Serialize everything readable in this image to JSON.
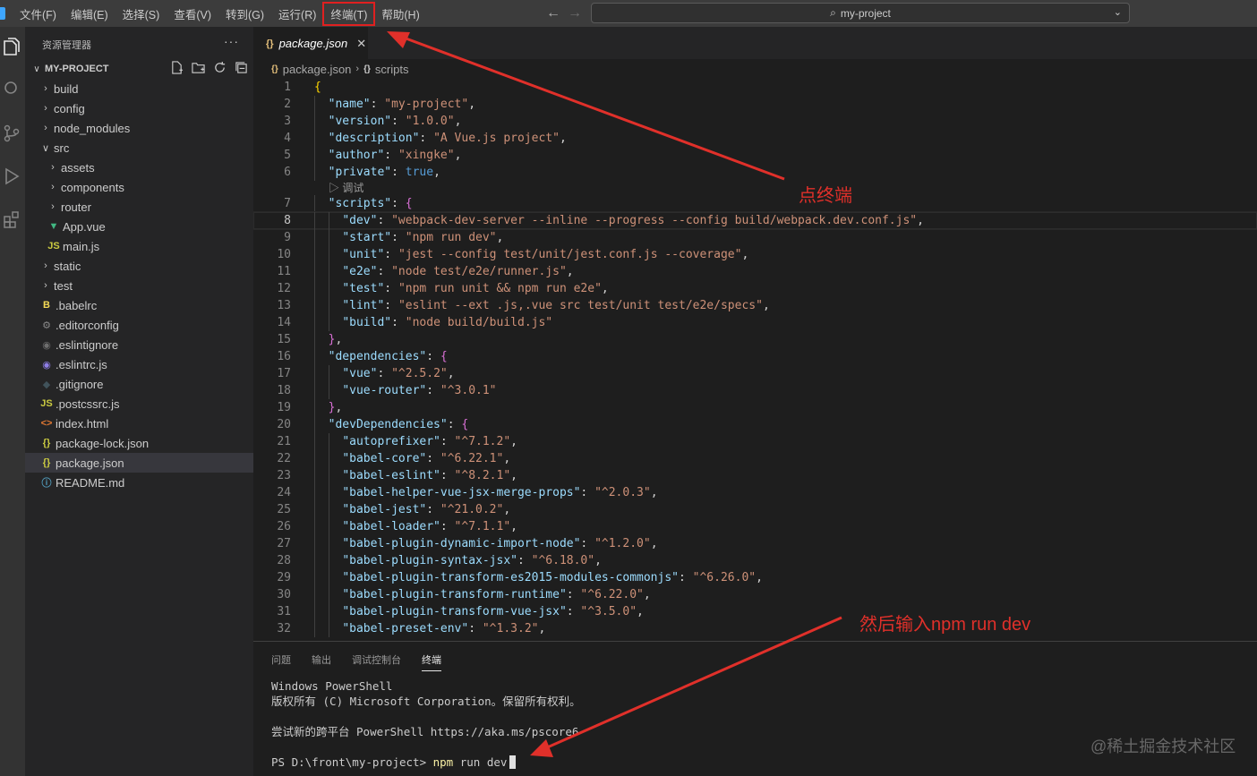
{
  "menu": {
    "items": [
      "文件(F)",
      "编辑(E)",
      "选择(S)",
      "查看(V)",
      "转到(G)",
      "运行(R)",
      "终端(T)",
      "帮助(H)"
    ],
    "highlighted_item": "终端(T)"
  },
  "command_center": {
    "text": "my-project",
    "icon": "search-icon"
  },
  "sidebar": {
    "title": "资源管理器",
    "more": "···",
    "project": "MY-PROJECT",
    "tree": [
      {
        "label": "build",
        "type": "folder",
        "expanded": false,
        "depth": 1
      },
      {
        "label": "config",
        "type": "folder",
        "expanded": false,
        "depth": 1
      },
      {
        "label": "node_modules",
        "type": "folder",
        "expanded": false,
        "depth": 1
      },
      {
        "label": "src",
        "type": "folder",
        "expanded": true,
        "depth": 1
      },
      {
        "label": "assets",
        "type": "folder",
        "expanded": false,
        "depth": 2
      },
      {
        "label": "components",
        "type": "folder",
        "expanded": false,
        "depth": 2
      },
      {
        "label": "router",
        "type": "folder",
        "expanded": false,
        "depth": 2
      },
      {
        "label": "App.vue",
        "type": "file",
        "icon": "vue-icon",
        "depth": 2
      },
      {
        "label": "main.js",
        "type": "file",
        "icon": "js-icon",
        "depth": 2
      },
      {
        "label": "static",
        "type": "folder",
        "expanded": false,
        "depth": 1
      },
      {
        "label": "test",
        "type": "folder",
        "expanded": false,
        "depth": 1
      },
      {
        "label": ".babelrc",
        "type": "file",
        "icon": "babel-icon",
        "depth": 1
      },
      {
        "label": ".editorconfig",
        "type": "file",
        "icon": "gear-icon",
        "depth": 1
      },
      {
        "label": ".eslintignore",
        "type": "file",
        "icon": "eslint-ignore-icon",
        "depth": 1
      },
      {
        "label": ".eslintrc.js",
        "type": "file",
        "icon": "eslint-icon",
        "depth": 1
      },
      {
        "label": ".gitignore",
        "type": "file",
        "icon": "git-icon",
        "depth": 1
      },
      {
        "label": ".postcssrc.js",
        "type": "file",
        "icon": "js-icon",
        "depth": 1
      },
      {
        "label": "index.html",
        "type": "file",
        "icon": "html-icon",
        "depth": 1
      },
      {
        "label": "package-lock.json",
        "type": "file",
        "icon": "json-icon",
        "depth": 1
      },
      {
        "label": "package.json",
        "type": "file",
        "icon": "json-icon",
        "depth": 1,
        "selected": true
      },
      {
        "label": "README.md",
        "type": "file",
        "icon": "info-icon",
        "depth": 1
      }
    ]
  },
  "editor": {
    "tab": {
      "label": "package.json",
      "close": "✕"
    },
    "breadcrumb": [
      "package.json",
      "scripts"
    ],
    "codelens": "调试",
    "current_line": 8,
    "lines": [
      {
        "n": "1",
        "text": "{"
      },
      {
        "n": "2",
        "text": "  \"name\": \"my-project\","
      },
      {
        "n": "3",
        "text": "  \"version\": \"1.0.0\","
      },
      {
        "n": "4",
        "text": "  \"description\": \"A Vue.js project\","
      },
      {
        "n": "5",
        "text": "  \"author\": \"xingke\","
      },
      {
        "n": "6",
        "text": "  \"private\": true,"
      },
      {
        "n": "7",
        "text": "  \"scripts\": {"
      },
      {
        "n": "8",
        "text": "    \"dev\": \"webpack-dev-server --inline --progress --config build/webpack.dev.conf.js\","
      },
      {
        "n": "9",
        "text": "    \"start\": \"npm run dev\","
      },
      {
        "n": "10",
        "text": "    \"unit\": \"jest --config test/unit/jest.conf.js --coverage\","
      },
      {
        "n": "11",
        "text": "    \"e2e\": \"node test/e2e/runner.js\","
      },
      {
        "n": "12",
        "text": "    \"test\": \"npm run unit && npm run e2e\","
      },
      {
        "n": "13",
        "text": "    \"lint\": \"eslint --ext .js,.vue src test/unit test/e2e/specs\","
      },
      {
        "n": "14",
        "text": "    \"build\": \"node build/build.js\""
      },
      {
        "n": "15",
        "text": "  },"
      },
      {
        "n": "16",
        "text": "  \"dependencies\": {"
      },
      {
        "n": "17",
        "text": "    \"vue\": \"^2.5.2\","
      },
      {
        "n": "18",
        "text": "    \"vue-router\": \"^3.0.1\""
      },
      {
        "n": "19",
        "text": "  },"
      },
      {
        "n": "20",
        "text": "  \"devDependencies\": {"
      },
      {
        "n": "21",
        "text": "    \"autoprefixer\": \"^7.1.2\","
      },
      {
        "n": "22",
        "text": "    \"babel-core\": \"^6.22.1\","
      },
      {
        "n": "23",
        "text": "    \"babel-eslint\": \"^8.2.1\","
      },
      {
        "n": "24",
        "text": "    \"babel-helper-vue-jsx-merge-props\": \"^2.0.3\","
      },
      {
        "n": "25",
        "text": "    \"babel-jest\": \"^21.0.2\","
      },
      {
        "n": "26",
        "text": "    \"babel-loader\": \"^7.1.1\","
      },
      {
        "n": "27",
        "text": "    \"babel-plugin-dynamic-import-node\": \"^1.2.0\","
      },
      {
        "n": "28",
        "text": "    \"babel-plugin-syntax-jsx\": \"^6.18.0\","
      },
      {
        "n": "29",
        "text": "    \"babel-plugin-transform-es2015-modules-commonjs\": \"^6.26.0\","
      },
      {
        "n": "30",
        "text": "    \"babel-plugin-transform-runtime\": \"^6.22.0\","
      },
      {
        "n": "31",
        "text": "    \"babel-plugin-transform-vue-jsx\": \"^3.5.0\","
      },
      {
        "n": "32",
        "text": "    \"babel-preset-env\": \"^1.3.2\","
      }
    ]
  },
  "panel": {
    "tabs": [
      "问题",
      "输出",
      "调试控制台",
      "终端"
    ],
    "active_tab": "终端",
    "terminal": {
      "lines": [
        "Windows PowerShell",
        "版权所有 (C) Microsoft Corporation。保留所有权利。",
        "",
        "尝试新的跨平台 PowerShell https://aka.ms/pscore6",
        ""
      ],
      "prompt": "PS D:\\front\\my-project>",
      "command_word": "npm",
      "command_args": " run dev"
    }
  },
  "annotations": {
    "menu_hint": "点终端",
    "terminal_hint": "然后输入npm run dev",
    "color": "#e0302a"
  },
  "watermark": "@稀土掘金技术社区"
}
